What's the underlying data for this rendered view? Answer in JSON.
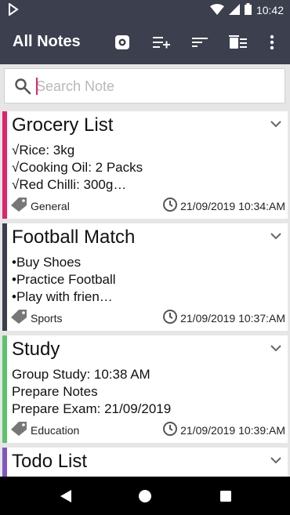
{
  "status_bar": {
    "time": "10:42"
  },
  "app_bar": {
    "title": "All Notes",
    "actions": [
      "settings-icon",
      "add-list-icon",
      "sort-icon",
      "delete-icon",
      "more-vert-icon"
    ]
  },
  "search": {
    "placeholder": "Search Note",
    "value": ""
  },
  "notes": [
    {
      "title": "Grocery List",
      "lines": [
        "√Rice: 3kg",
        "√Cooking Oil: 2 Packs",
        "√Red Chilli: 300g…"
      ],
      "category": "General",
      "timestamp": "21/09/2019 10:34:AM",
      "color": "#e0246a"
    },
    {
      "title": "Football Match",
      "lines": [
        "•Buy Shoes",
        "•Practice Football",
        "•Play with frien…"
      ],
      "category": "Sports",
      "timestamp": "21/09/2019 10:37:AM",
      "color": "#3b3f4e"
    },
    {
      "title": "Study",
      "lines": [
        "Group Study: 10:38 AM",
        "Prepare Notes",
        "Prepare Exam: 21/09/2019"
      ],
      "category": "Education",
      "timestamp": "21/09/2019 10:39:AM",
      "color": "#5cc46a"
    },
    {
      "title": "Todo List",
      "lines": [],
      "category": "",
      "timestamp": "",
      "color": "#7e57c2"
    }
  ]
}
